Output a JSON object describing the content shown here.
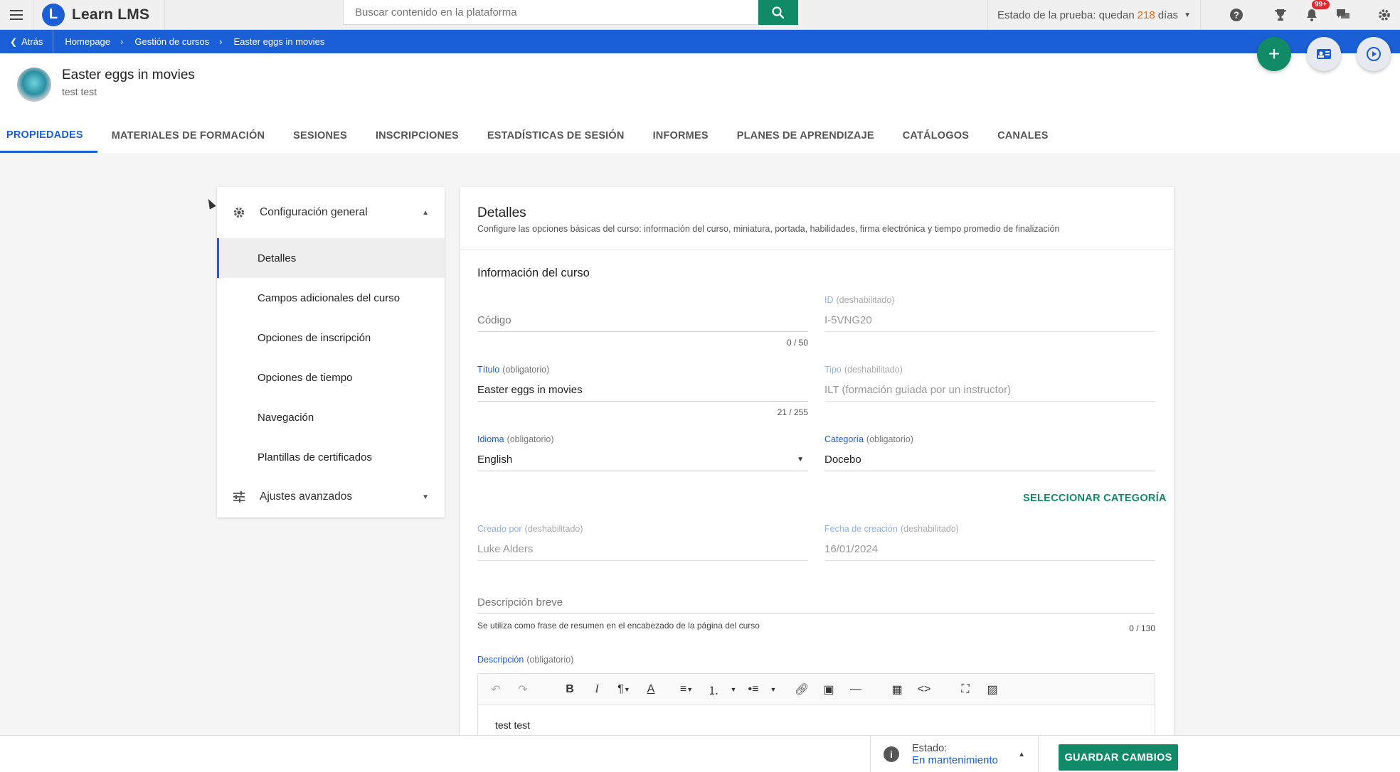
{
  "topbar": {
    "logo_mark": "L",
    "logo_text": "Learn LMS",
    "search_placeholder": "Buscar contenido en la plataforma",
    "trial_prefix": "Estado de la prueba: quedan",
    "trial_days": "218",
    "trial_suffix": "días",
    "notifications_badge": "99+",
    "accent_color": "#1a5fd6",
    "primary_green": "#118a67"
  },
  "breadcrumb": {
    "back_label": "Atrás",
    "items": [
      "Homepage",
      "Gestión de cursos",
      "Easter eggs in movies"
    ]
  },
  "header": {
    "title": "Easter eggs in movies",
    "subtitle": "test test",
    "fab_add": "+"
  },
  "tabs": [
    {
      "label": "PROPIEDADES",
      "active": true
    },
    {
      "label": "MATERIALES DE FORMACIÓN"
    },
    {
      "label": "SESIONES"
    },
    {
      "label": "INSCRIPCIONES"
    },
    {
      "label": "ESTADÍSTICAS DE SESIÓN"
    },
    {
      "label": "INFORMES"
    },
    {
      "label": "PLANES DE APRENDIZAJE"
    },
    {
      "label": "CATÁLOGOS"
    },
    {
      "label": "CANALES"
    }
  ],
  "sidebar": {
    "group1": "Configuración general",
    "items": [
      "Detalles",
      "Campos adicionales del curso",
      "Opciones de inscripción",
      "Opciones de tiempo",
      "Navegación",
      "Plantillas de certificados"
    ],
    "group2": "Ajustes avanzados"
  },
  "panel": {
    "title": "Detalles",
    "description": "Configure las opciones básicas del curso: información del curso, miniatura, portada, habilidades, firma electrónica y tiempo promedio de finalización",
    "section_title": "Información del curso",
    "code": {
      "placeholder": "Código",
      "counter": "0 / 50"
    },
    "id": {
      "label": "ID",
      "note": "(deshabilitado)",
      "value": "I-5VNG20"
    },
    "title_field": {
      "label": "Título",
      "note": "(obligatorio)",
      "value": "Easter eggs in movies",
      "counter": "21 / 255"
    },
    "type": {
      "label": "Tipo",
      "note": "(deshabilitado)",
      "value": "ILT (formación guiada por un instructor)"
    },
    "language": {
      "label": "Idioma",
      "note": "(obligatorio)",
      "value": "English"
    },
    "category": {
      "label": "Categoría",
      "note": "(obligatorio)",
      "value": "Docebo"
    },
    "select_category": "SELECCIONAR CATEGORÍA",
    "created_by": {
      "label": "Creado por",
      "note": "(deshabilitado)",
      "value": "Luke Alders"
    },
    "created_date": {
      "label": "Fecha de creación",
      "note": "(deshabilitado)",
      "value": "16/01/2024"
    },
    "short_desc": {
      "placeholder": "Descripción breve",
      "help": "Se utiliza como frase de resumen en el encabezado de la página del curso",
      "counter": "0 / 130"
    },
    "description_field": {
      "label": "Descripción",
      "note": "(obligatorio)",
      "content": "test test"
    }
  },
  "footer": {
    "status_label": "Estado:",
    "status_value": "En mantenimiento",
    "save_label": "GUARDAR CAMBIOS"
  }
}
